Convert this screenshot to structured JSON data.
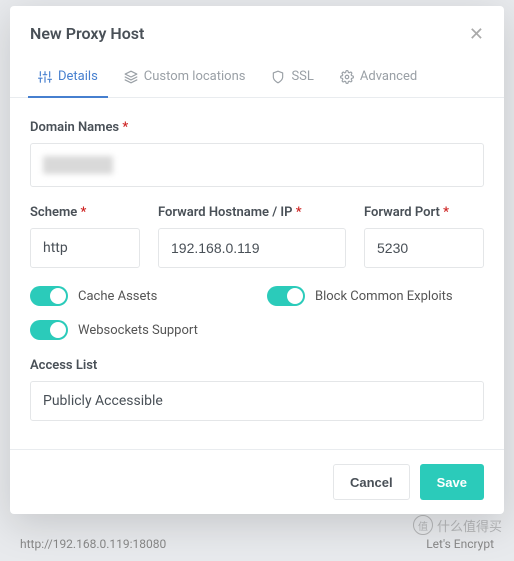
{
  "modal": {
    "title": "New Proxy Host",
    "tabs": {
      "details": "Details",
      "custom": "Custom locations",
      "ssl": "SSL",
      "advanced": "Advanced"
    },
    "labels": {
      "domain": "Domain Names",
      "scheme": "Scheme",
      "host": "Forward Hostname / IP",
      "port": "Forward Port",
      "access": "Access List"
    },
    "values": {
      "scheme": "http",
      "host": "192.168.0.119",
      "port": "5230",
      "access": "Publicly Accessible"
    },
    "toggles": {
      "cache": "Cache Assets",
      "block": "Block Common Exploits",
      "ws": "Websockets Support"
    },
    "buttons": {
      "cancel": "Cancel",
      "save": "Save"
    }
  },
  "req_marker": "*",
  "background": {
    "url": "http://192.168.0.119:18080",
    "cert": "Let's Encrypt"
  },
  "watermark": {
    "glyph": "值",
    "text": "什么值得买"
  }
}
